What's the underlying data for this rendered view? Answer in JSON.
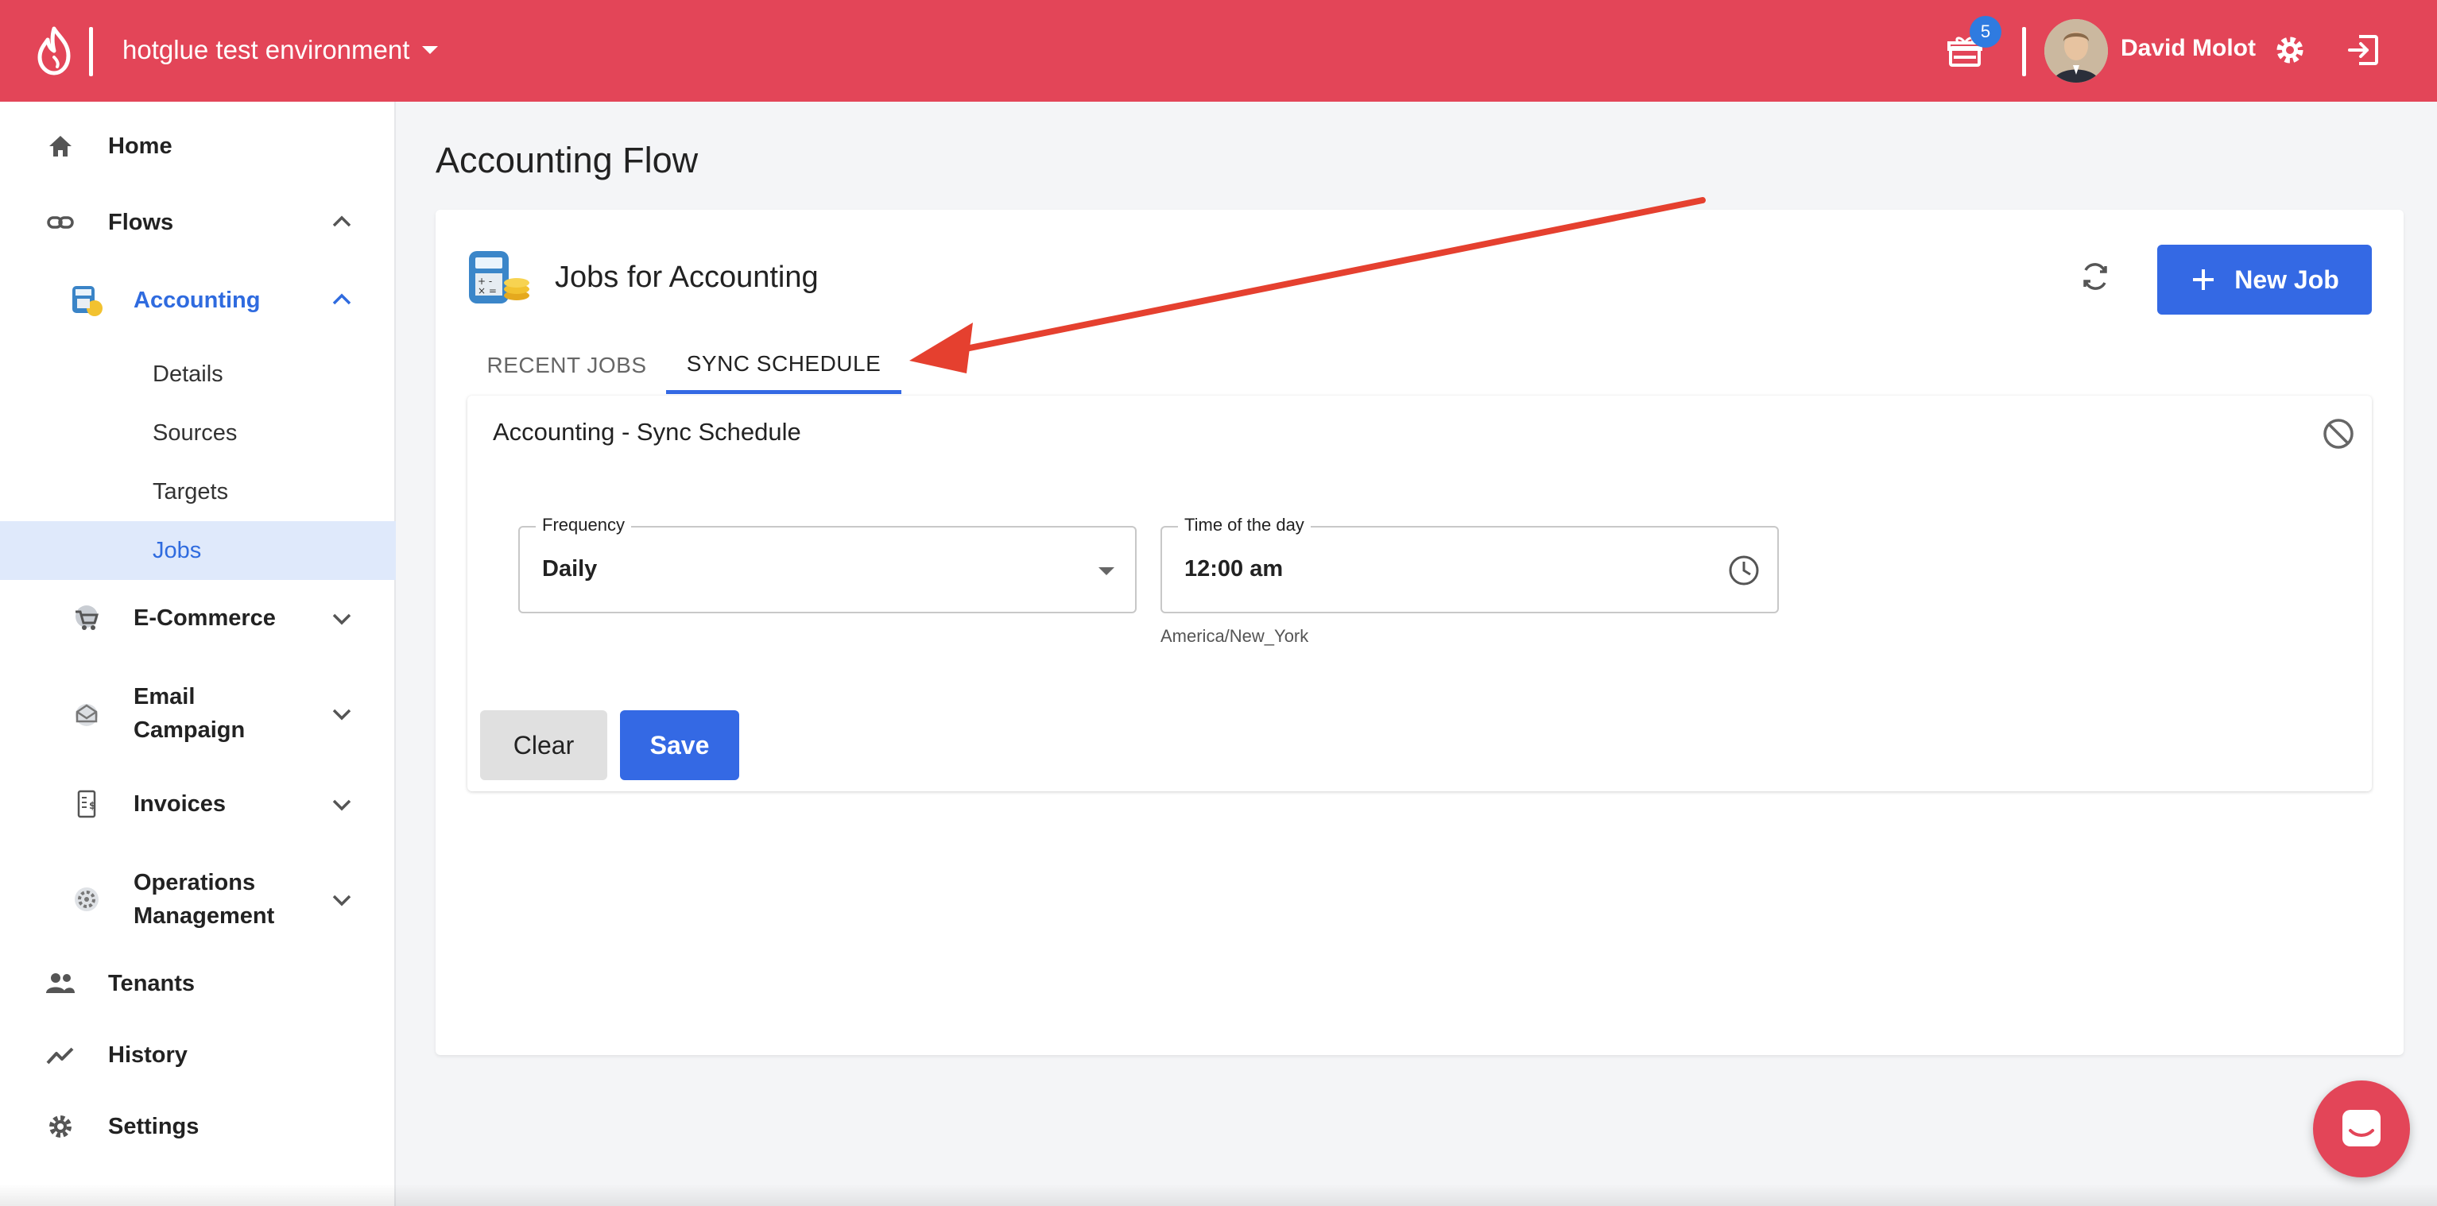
{
  "brand": {
    "color": "#e34558",
    "accent": "#3469e4"
  },
  "topbar": {
    "environment": "hotglue test environment",
    "notifications_count": "5",
    "user_name": "David Molot"
  },
  "sidebar": {
    "home": "Home",
    "flows": "Flows",
    "accounting": "Accounting",
    "accounting_children": [
      "Details",
      "Sources",
      "Targets",
      "Jobs"
    ],
    "ecommerce": "E-Commerce",
    "email_campaign": "Email Campaign",
    "invoices": "Invoices",
    "operations": "Operations Management",
    "tenants": "Tenants",
    "history": "History",
    "settings": "Settings"
  },
  "main": {
    "page_title": "Accounting Flow",
    "card_title": "Jobs for Accounting",
    "new_job": "New Job",
    "tabs": [
      "RECENT JOBS",
      "SYNC SCHEDULE"
    ],
    "active_tab": "SYNC SCHEDULE",
    "schedule": {
      "title": "Accounting - Sync Schedule",
      "frequency_label": "Frequency",
      "frequency_value": "Daily",
      "time_label": "Time of the day",
      "time_value": "12:00 am",
      "timezone": "America/New_York",
      "clear": "Clear",
      "save": "Save"
    }
  }
}
